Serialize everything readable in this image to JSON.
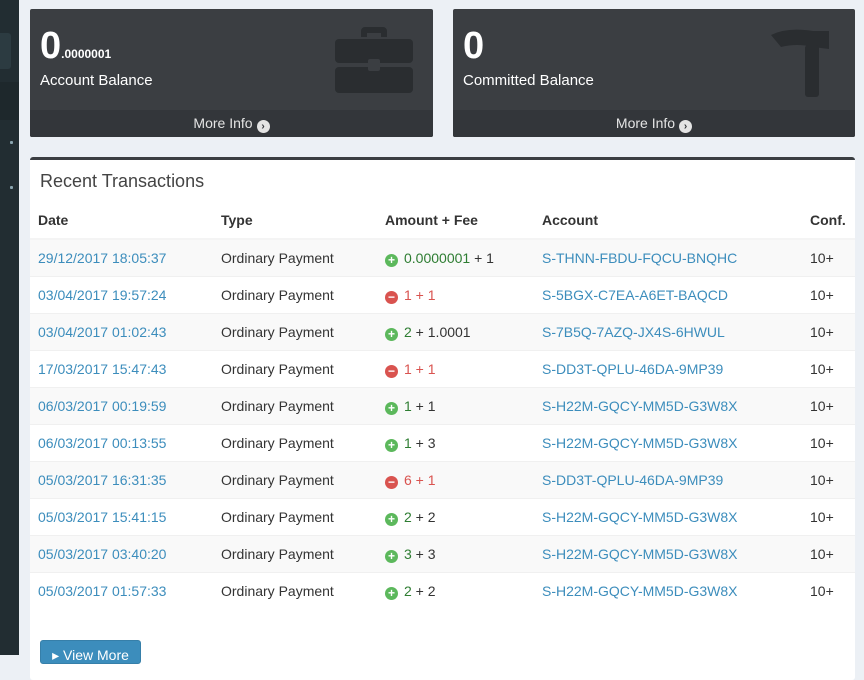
{
  "boxes": [
    {
      "value_main": "0",
      "value_small": ".0000001",
      "label": "Account Balance",
      "footer": "More Info",
      "icon": "briefcase-icon"
    },
    {
      "value_main": "0",
      "value_small": "",
      "label": "Committed Balance",
      "footer": "More Info",
      "icon": "hammer-icon"
    }
  ],
  "transactions": {
    "title": "Recent Transactions",
    "headers": {
      "date": "Date",
      "type": "Type",
      "amount": "Amount + Fee",
      "account": "Account",
      "conf": "Conf."
    },
    "rows": [
      {
        "date": "29/12/2017 18:05:37",
        "type": "Ordinary Payment",
        "sign": "+",
        "amount": "0.0000001",
        "fee": "1",
        "account": "S-THNN-FBDU-FQCU-BNQHC",
        "conf": "10+"
      },
      {
        "date": "03/04/2017 19:57:24",
        "type": "Ordinary Payment",
        "sign": "-",
        "amount": "1",
        "fee": "1",
        "account": "S-5BGX-C7EA-A6ET-BAQCD",
        "conf": "10+"
      },
      {
        "date": "03/04/2017 01:02:43",
        "type": "Ordinary Payment",
        "sign": "+",
        "amount": "2",
        "fee": "1.0001",
        "account": "S-7B5Q-7AZQ-JX4S-6HWUL",
        "conf": "10+"
      },
      {
        "date": "17/03/2017 15:47:43",
        "type": "Ordinary Payment",
        "sign": "-",
        "amount": "1",
        "fee": "1",
        "account": "S-DD3T-QPLU-46DA-9MP39",
        "conf": "10+"
      },
      {
        "date": "06/03/2017 00:19:59",
        "type": "Ordinary Payment",
        "sign": "+",
        "amount": "1",
        "fee": "1",
        "account": "S-H22M-GQCY-MM5D-G3W8X",
        "conf": "10+"
      },
      {
        "date": "06/03/2017 00:13:55",
        "type": "Ordinary Payment",
        "sign": "+",
        "amount": "1",
        "fee": "3",
        "account": "S-H22M-GQCY-MM5D-G3W8X",
        "conf": "10+"
      },
      {
        "date": "05/03/2017 16:31:35",
        "type": "Ordinary Payment",
        "sign": "-",
        "amount": "6",
        "fee": "1",
        "account": "S-DD3T-QPLU-46DA-9MP39",
        "conf": "10+"
      },
      {
        "date": "05/03/2017 15:41:15",
        "type": "Ordinary Payment",
        "sign": "+",
        "amount": "2",
        "fee": "2",
        "account": "S-H22M-GQCY-MM5D-G3W8X",
        "conf": "10+"
      },
      {
        "date": "05/03/2017 03:40:20",
        "type": "Ordinary Payment",
        "sign": "+",
        "amount": "3",
        "fee": "3",
        "account": "S-H22M-GQCY-MM5D-G3W8X",
        "conf": "10+"
      },
      {
        "date": "05/03/2017 01:57:33",
        "type": "Ordinary Payment",
        "sign": "+",
        "amount": "2",
        "fee": "2",
        "account": "S-H22M-GQCY-MM5D-G3W8X",
        "conf": "10+"
      }
    ],
    "view_more": "View More"
  },
  "colors": {
    "link": "#3c8dbc",
    "positive": "#2e7d32",
    "negative": "#d9534f",
    "box_bg": "#3b3e42"
  }
}
